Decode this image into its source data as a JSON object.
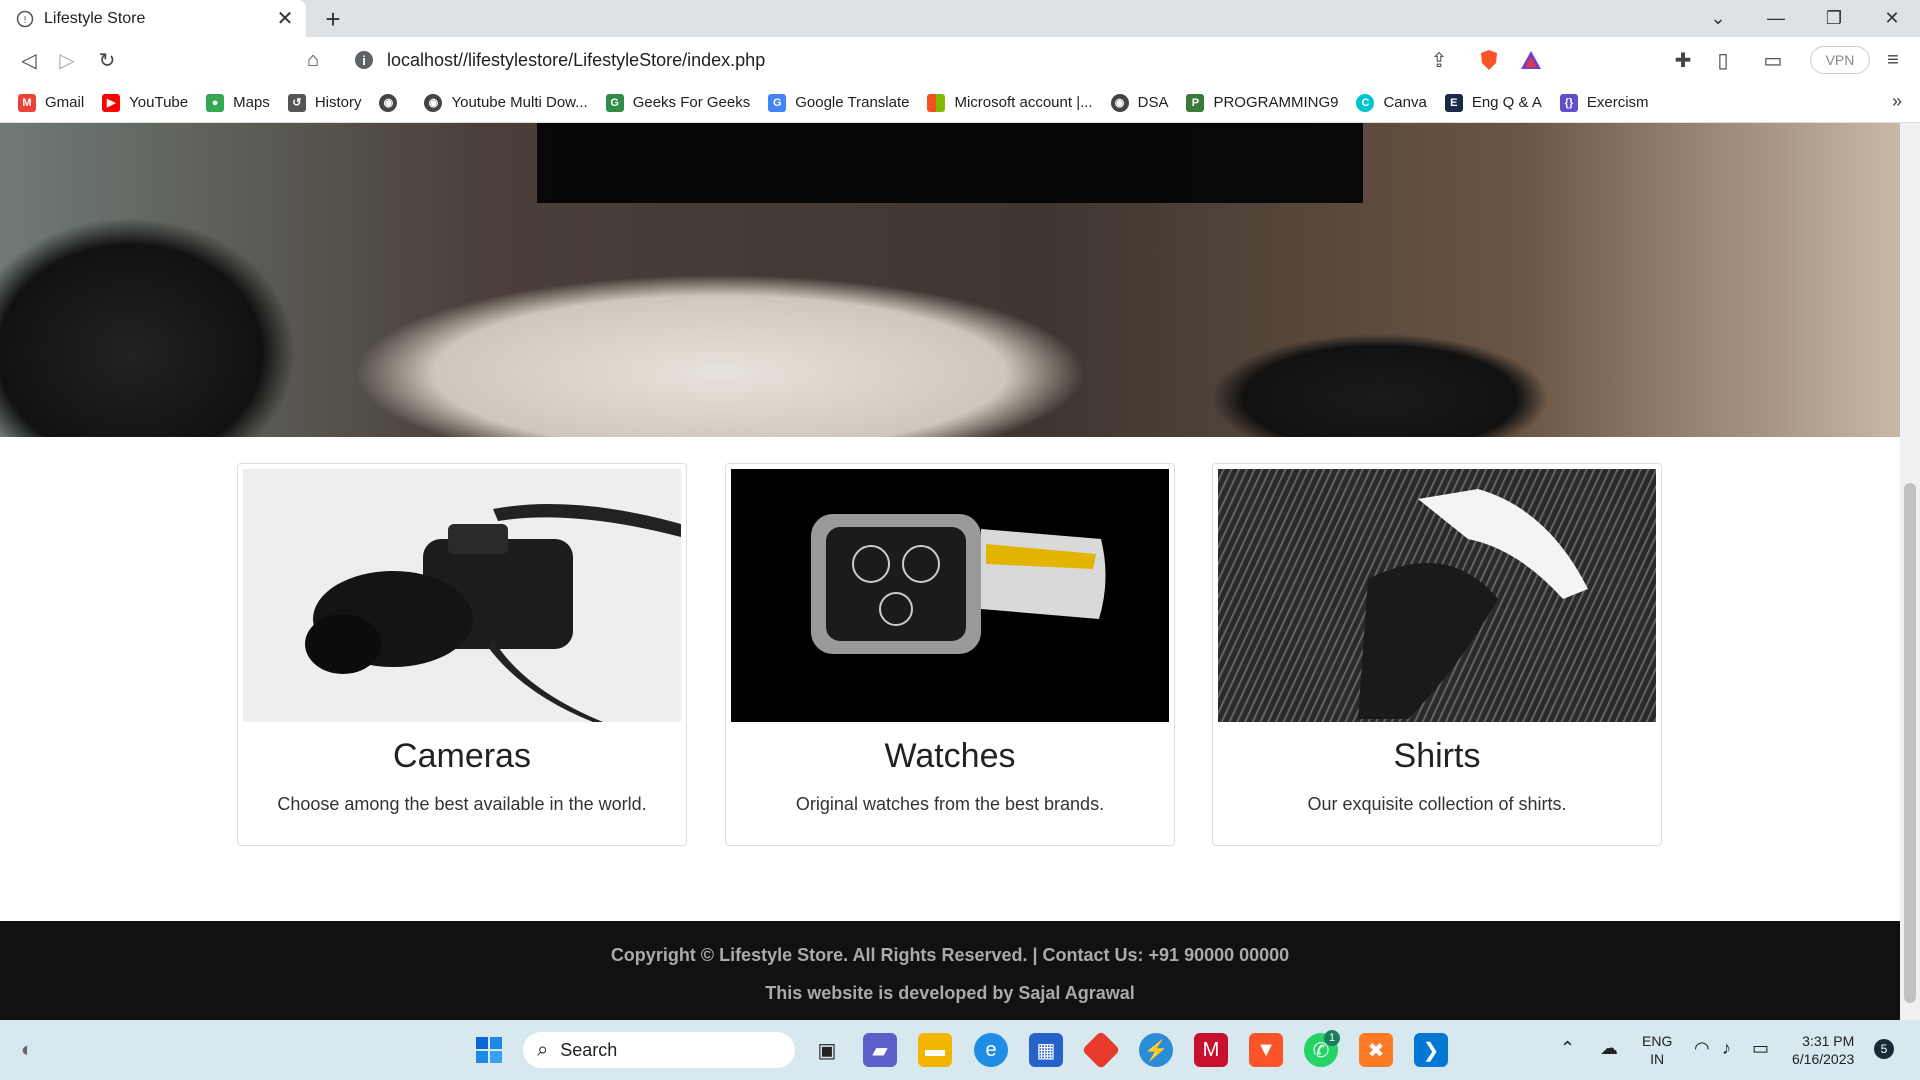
{
  "browser": {
    "tab_title": "Lifestyle Store",
    "url": "localhost//lifestylestore/LifestyleStore/index.php",
    "vpn_label": "VPN",
    "bookmarks": [
      {
        "label": "Gmail",
        "icon": "gmail-icon",
        "color": "#ea4335"
      },
      {
        "label": "YouTube",
        "icon": "youtube-icon",
        "color": "#ff0000"
      },
      {
        "label": "Maps",
        "icon": "maps-icon",
        "color": "#34a853"
      },
      {
        "label": "History",
        "icon": "history-icon",
        "color": "#555555"
      },
      {
        "label": "",
        "icon": "globe-icon",
        "color": "#444444"
      },
      {
        "label": "Youtube Multi Dow...",
        "icon": "globe-icon",
        "color": "#444444"
      },
      {
        "label": "Geeks For Geeks",
        "icon": "gfg-icon",
        "color": "#2f8d46"
      },
      {
        "label": "Google Translate",
        "icon": "translate-icon",
        "color": "#4285f4"
      },
      {
        "label": "Microsoft account |...",
        "icon": "microsoft-icon",
        "color": "#f25022"
      },
      {
        "label": "DSA",
        "icon": "globe-icon",
        "color": "#444444"
      },
      {
        "label": "PROGRAMMING9",
        "icon": "programming-icon",
        "color": "#3a7a3a"
      },
      {
        "label": "Canva",
        "icon": "canva-icon",
        "color": "#00c4cc"
      },
      {
        "label": "Eng Q & A",
        "icon": "engqa-icon",
        "color": "#1a2a4a"
      },
      {
        "label": "Exercism",
        "icon": "exercism-icon",
        "color": "#604fcd"
      }
    ]
  },
  "page": {
    "cards": [
      {
        "title": "Cameras",
        "desc": "Choose among the best available in the world."
      },
      {
        "title": "Watches",
        "desc": "Original watches from the best brands."
      },
      {
        "title": "Shirts",
        "desc": "Our exquisite collection of shirts."
      }
    ],
    "footer": {
      "line1": "Copyright © Lifestyle Store. All Rights Reserved. | Contact Us: +91 90000 00000",
      "line2": "This website is developed by Sajal Agrawal"
    }
  },
  "taskbar": {
    "search_label": "Search",
    "lang_line1": "ENG",
    "lang_line2": "IN",
    "time": "3:31 PM",
    "date": "6/16/2023",
    "notification_count": "5",
    "whatsapp_badge": "1"
  }
}
